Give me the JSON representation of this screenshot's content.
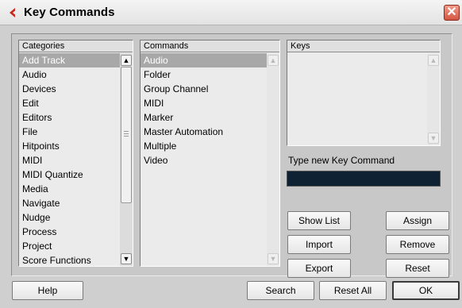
{
  "window": {
    "title": "Key Commands",
    "close_glyph": "✕",
    "logo_icon": "cubase-logo-icon",
    "close_icon": "close-icon"
  },
  "categories": {
    "header": "Categories",
    "selected_index": 0,
    "items": [
      "Add Track",
      "Audio",
      "Devices",
      "Edit",
      "Editors",
      "File",
      "Hitpoints",
      "MIDI",
      "MIDI Quantize",
      "Media",
      "Navigate",
      "Nudge",
      "Process",
      "Project",
      "Score Functions"
    ]
  },
  "commands": {
    "header": "Commands",
    "selected_index": 0,
    "items": [
      "Audio",
      "Folder",
      "Group Channel",
      "MIDI",
      "Marker",
      "Master Automation",
      "Multiple",
      "Video"
    ]
  },
  "keys": {
    "header": "Keys",
    "items": []
  },
  "new_key": {
    "label": "Type new Key Command",
    "value": ""
  },
  "buttons": {
    "show_list": "Show List",
    "import": "Import",
    "export": "Export",
    "assign": "Assign",
    "remove": "Remove",
    "reset": "Reset",
    "help": "Help",
    "search": "Search",
    "reset_all": "Reset All",
    "ok": "OK"
  },
  "scroll": {
    "up_glyph": "▲",
    "down_glyph": "▼"
  },
  "colors": {
    "accent_logo": "#c8281e",
    "selection": "#a8a8a8",
    "key_input_bg": "#0f2233",
    "close_button": "#d35642"
  }
}
